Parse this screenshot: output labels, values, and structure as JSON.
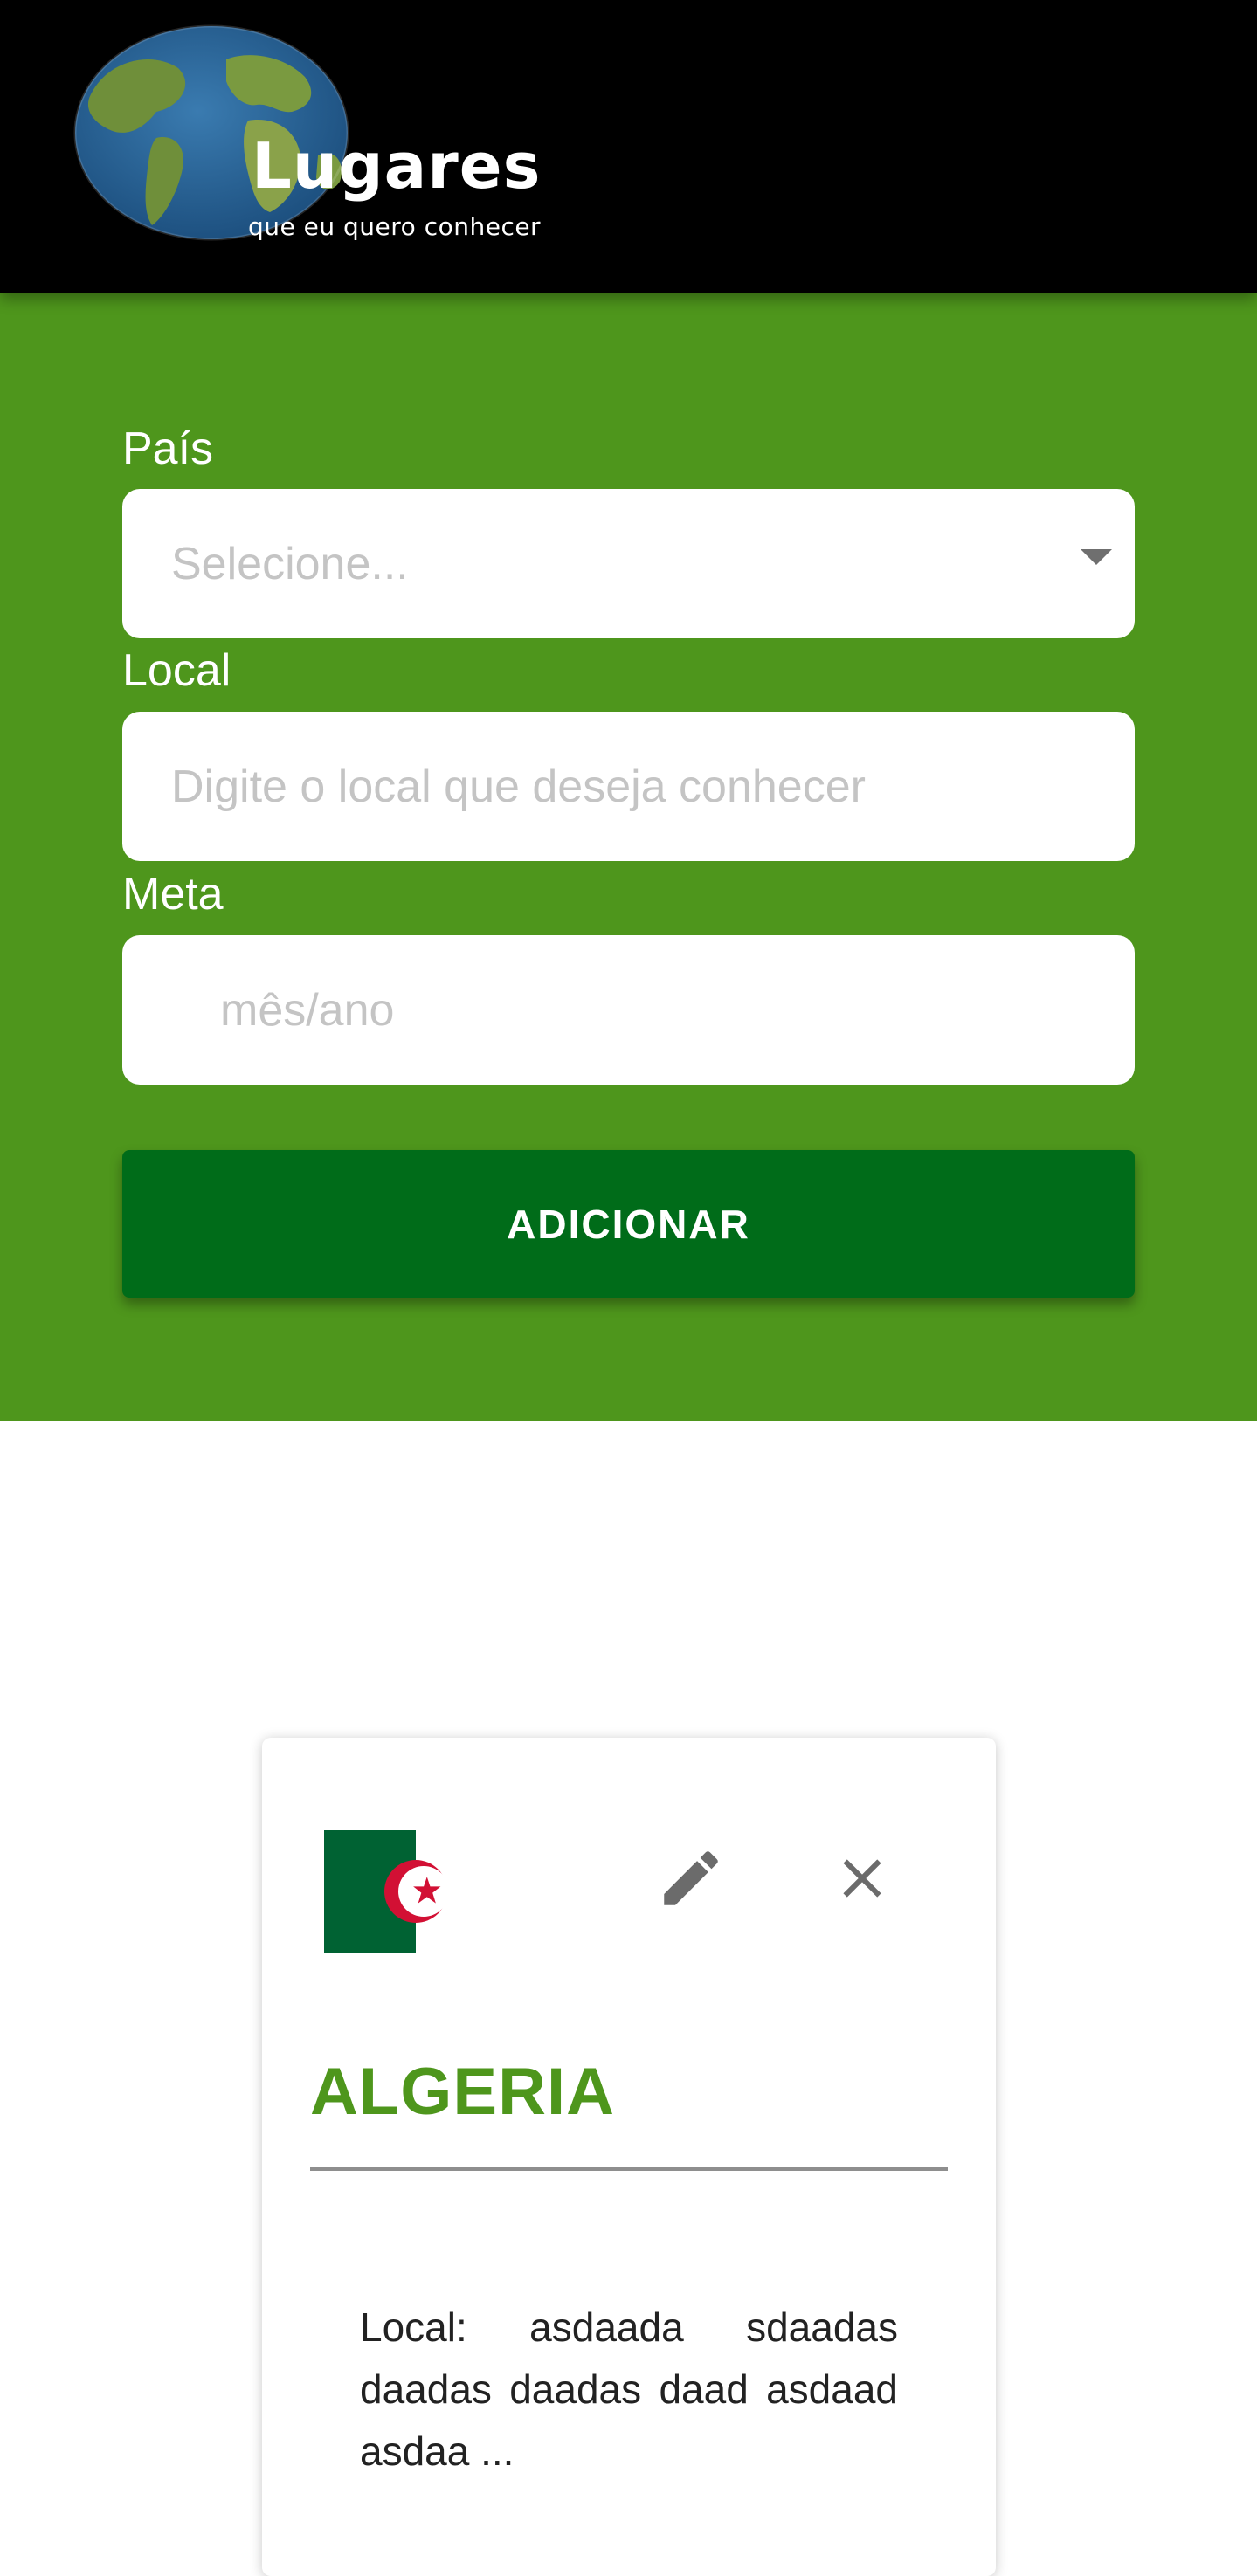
{
  "header": {
    "logo_title": "Lugares",
    "logo_subtitle": "que eu quero conhecer"
  },
  "form": {
    "country": {
      "label": "País",
      "placeholder": "Selecione..."
    },
    "place": {
      "label": "Local",
      "placeholder": "Digite o local que deseja conhecer"
    },
    "goal": {
      "label": "Meta",
      "placeholder": "mês/ano"
    },
    "submit_label": "ADICIONAR"
  },
  "card": {
    "country_name": "ALGERIA",
    "flag_icon": "algeria-flag-icon",
    "edit_icon": "pencil-icon",
    "delete_icon": "close-icon",
    "local_text": "Local: asdaada sdaadas daadas daadas daad asdaad asdaa ..."
  },
  "colors": {
    "header_bg": "#000000",
    "form_bg": "#4e961c",
    "button_bg": "#006c19",
    "title_green": "#4e961c"
  }
}
